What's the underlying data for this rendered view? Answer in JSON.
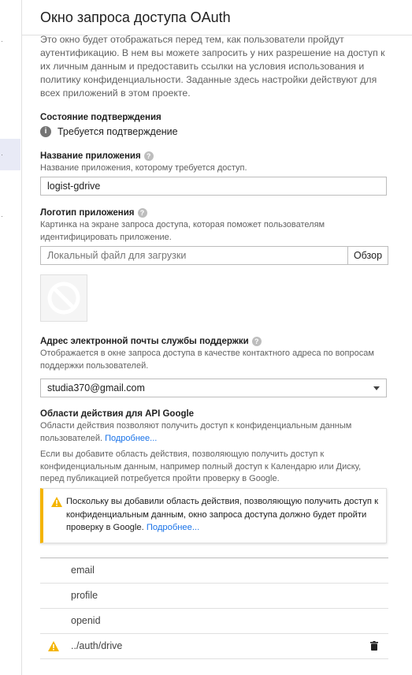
{
  "header": {
    "title": "Окно запроса доступа OAuth"
  },
  "intro": "Это окно будет отображаться перед тем, как пользователи пройдут аутентификацию. В нем вы можете запросить у них разрешение на доступ к их личным данным и предоставить ссылки на условия использования и политику конфиденциальности. Заданные здесь настройки действуют для всех приложений в этом проекте.",
  "verification": {
    "label": "Состояние подтверждения",
    "status": "Требуется подтверждение"
  },
  "app_name": {
    "label": "Название приложения",
    "description": "Название приложения, которому требуется доступ.",
    "value": "logist-gdrive"
  },
  "app_logo": {
    "label": "Логотип приложения",
    "description": "Картинка на экране запроса доступа, которая поможет пользователям идентифицировать приложение.",
    "placeholder": "Локальный файл для загрузки",
    "browse_label": "Обзор"
  },
  "support_email": {
    "label": "Адрес электронной почты службы поддержки",
    "description": "Отображается в окне запроса доступа в качестве контактного адреса по вопросам поддержки пользователей.",
    "value": "studia370@gmail.com"
  },
  "scopes": {
    "label": "Области действия для API Google",
    "description": "Области действия позволяют получить доступ к конфиденциальным данным пользователей.",
    "more_link": "Подробнее...",
    "note": "Если вы добавите область действия, позволяющую получить доступ к конфиденциальным данным, например полный доступ к Календарю или Диску, перед публикацией потребуется пройти проверку в Google.",
    "warning_text": "Поскольку вы добавили область действия, позволяющую получить доступ к конфиденциальным данным, окно запроса доступа должно будет пройти проверку в Google.",
    "warning_link": "Подробнее...",
    "items": [
      {
        "label": "email"
      },
      {
        "label": "profile"
      },
      {
        "label": "openid"
      },
      {
        "label": "../auth/drive"
      }
    ]
  },
  "colors": {
    "accent": "#1a73e8",
    "warning": "#f4b400",
    "text_primary": "#212121",
    "text_secondary": "#616161"
  }
}
